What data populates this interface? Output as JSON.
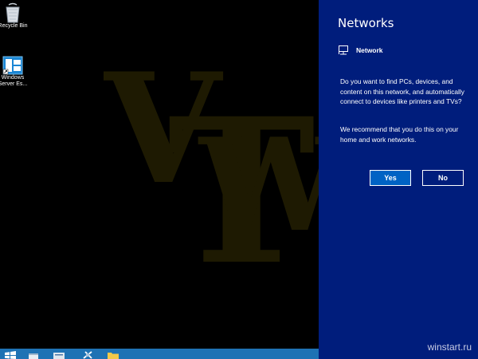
{
  "desktop": {
    "icons": [
      {
        "label": "Recycle Bin",
        "icon": "recycle-bin-icon"
      },
      {
        "label": "Windows\nServer Es...",
        "icon": "server-essentials-icon"
      }
    ],
    "watermark_logo": "VTW"
  },
  "taskbar": {
    "items": [
      "start-icon",
      "internet-explorer-icon",
      "server-manager-icon",
      "admin-tools-icon",
      "file-explorer-icon"
    ],
    "color": "#1e72b4"
  },
  "charm": {
    "title": "Networks",
    "network_name": "Network",
    "question": "Do you want to find PCs, devices, and content on this network, and automatically connect to devices like printers and TVs?",
    "recommendation": "We recommend that you do this on your home and work networks.",
    "yes_label": "Yes",
    "no_label": "No",
    "background": "#001d7c",
    "accent": "#0063c4"
  },
  "site_watermark": "winstart.ru"
}
